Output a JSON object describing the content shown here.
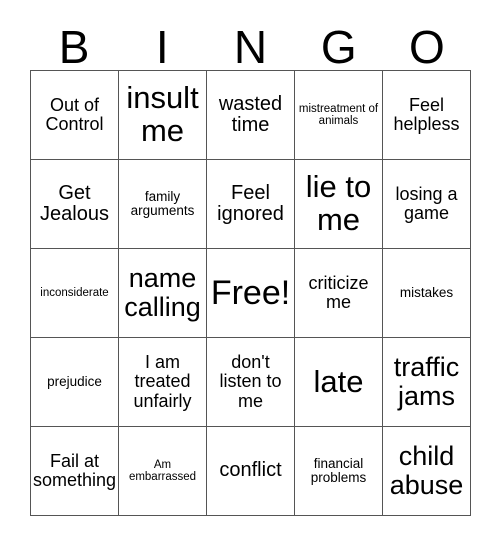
{
  "card": {
    "title_letters": [
      "B",
      "I",
      "N",
      "G",
      "O"
    ],
    "free_space_label": "Free!",
    "grid_line_color": "#555555",
    "text_color": "#000000",
    "background_color": "#ffffff",
    "rows": [
      [
        {
          "text": "Out of Control",
          "size": "fs-m"
        },
        {
          "text": "insult me",
          "size": "fs-xxl"
        },
        {
          "text": "wasted time",
          "size": "fs-ml"
        },
        {
          "text": "mistreatment of animals",
          "size": "fs-xs"
        },
        {
          "text": "Feel helpless",
          "size": "fs-m"
        }
      ],
      [
        {
          "text": "Get Jealous",
          "size": "fs-ml"
        },
        {
          "text": "family arguments",
          "size": "fs-s"
        },
        {
          "text": "Feel ignored",
          "size": "fs-ml"
        },
        {
          "text": "lie to me",
          "size": "fs-xxl"
        },
        {
          "text": "losing a game",
          "size": "fs-m"
        }
      ],
      [
        {
          "text": "inconsiderate",
          "size": "fs-xs"
        },
        {
          "text": "name calling",
          "size": "fs-xl"
        },
        {
          "text": "Free!",
          "size": "fs-huge"
        },
        {
          "text": "criticize me",
          "size": "fs-m"
        },
        {
          "text": "mistakes",
          "size": "fs-s"
        }
      ],
      [
        {
          "text": "prejudice",
          "size": "fs-s"
        },
        {
          "text": "I am treated unfairly",
          "size": "fs-m"
        },
        {
          "text": "don't listen to me",
          "size": "fs-m"
        },
        {
          "text": "late",
          "size": "fs-xxl"
        },
        {
          "text": "traffic jams",
          "size": "fs-xl"
        }
      ],
      [
        {
          "text": "Fail at something",
          "size": "fs-m"
        },
        {
          "text": "Am embarrassed",
          "size": "fs-xs"
        },
        {
          "text": "conflict",
          "size": "fs-ml"
        },
        {
          "text": "financial problems",
          "size": "fs-s"
        },
        {
          "text": "child abuse",
          "size": "fs-xl"
        }
      ]
    ]
  }
}
